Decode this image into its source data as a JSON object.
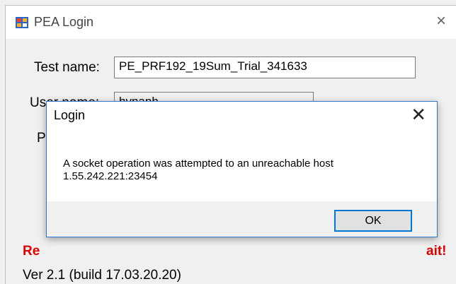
{
  "window": {
    "title": "PEA Login",
    "close_glyph": "×"
  },
  "form": {
    "test_name_label": "Test name:",
    "test_name_value": "PE_PRF192_19Sum_Trial_341633",
    "user_name_label": "User name:",
    "user_name_value": "hvnanh",
    "password_label_partial": "P"
  },
  "warning": {
    "visible_start": "Re",
    "visible_end": "ait!"
  },
  "version": "Ver 2.1 (build 17.03.20.20)",
  "dialog": {
    "title": "Login",
    "close_glyph": "✕",
    "message_line1": "A socket operation was attempted to an unreachable host",
    "message_line2": "1.55.242.221:23454",
    "ok_label": "OK"
  },
  "colors": {
    "accent": "#0078d7",
    "warning": "#e00000"
  }
}
